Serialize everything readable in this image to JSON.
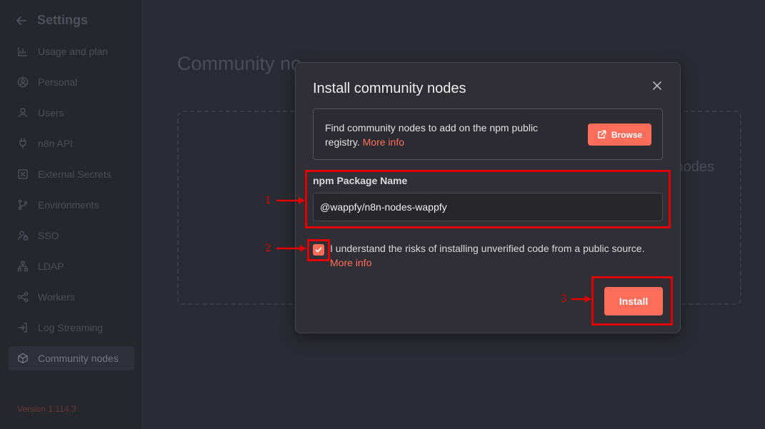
{
  "sidebar": {
    "title": "Settings",
    "items": [
      {
        "label": "Usage and plan",
        "icon": "chart-bar-icon"
      },
      {
        "label": "Personal",
        "icon": "user-circle-icon"
      },
      {
        "label": "Users",
        "icon": "user-icon"
      },
      {
        "label": "n8n API",
        "icon": "plug-icon"
      },
      {
        "label": "External Secrets",
        "icon": "vault-icon"
      },
      {
        "label": "Environments",
        "icon": "branch-icon"
      },
      {
        "label": "SSO",
        "icon": "user-lock-icon"
      },
      {
        "label": "LDAP",
        "icon": "network-icon"
      },
      {
        "label": "Workers",
        "icon": "workers-icon"
      },
      {
        "label": "Log Streaming",
        "icon": "sign-in-icon"
      },
      {
        "label": "Community nodes",
        "icon": "cube-icon"
      }
    ],
    "active_item": "Community nodes",
    "version": "Version 1.114.3"
  },
  "main": {
    "title": "Community no",
    "empty_text": "y nodes"
  },
  "modal": {
    "title": "Install community nodes",
    "info_text": "Find community nodes to add on the npm public registry.",
    "info_link": "More info",
    "browse_label": "Browse",
    "field_label": "npm Package Name",
    "package_value": "@wappfy/n8n-nodes-wappfy",
    "checkbox_checked": true,
    "checkbox_text": "I understand the risks of installing unverified code from a public source.",
    "checkbox_link": "More info",
    "install_label": "Install"
  },
  "annotations": [
    "1",
    "2",
    "3"
  ],
  "colors": {
    "accent": "#ff6d5a",
    "annotation": "#e00000",
    "background": "#2b2b33",
    "modal": "#2f2f35"
  }
}
